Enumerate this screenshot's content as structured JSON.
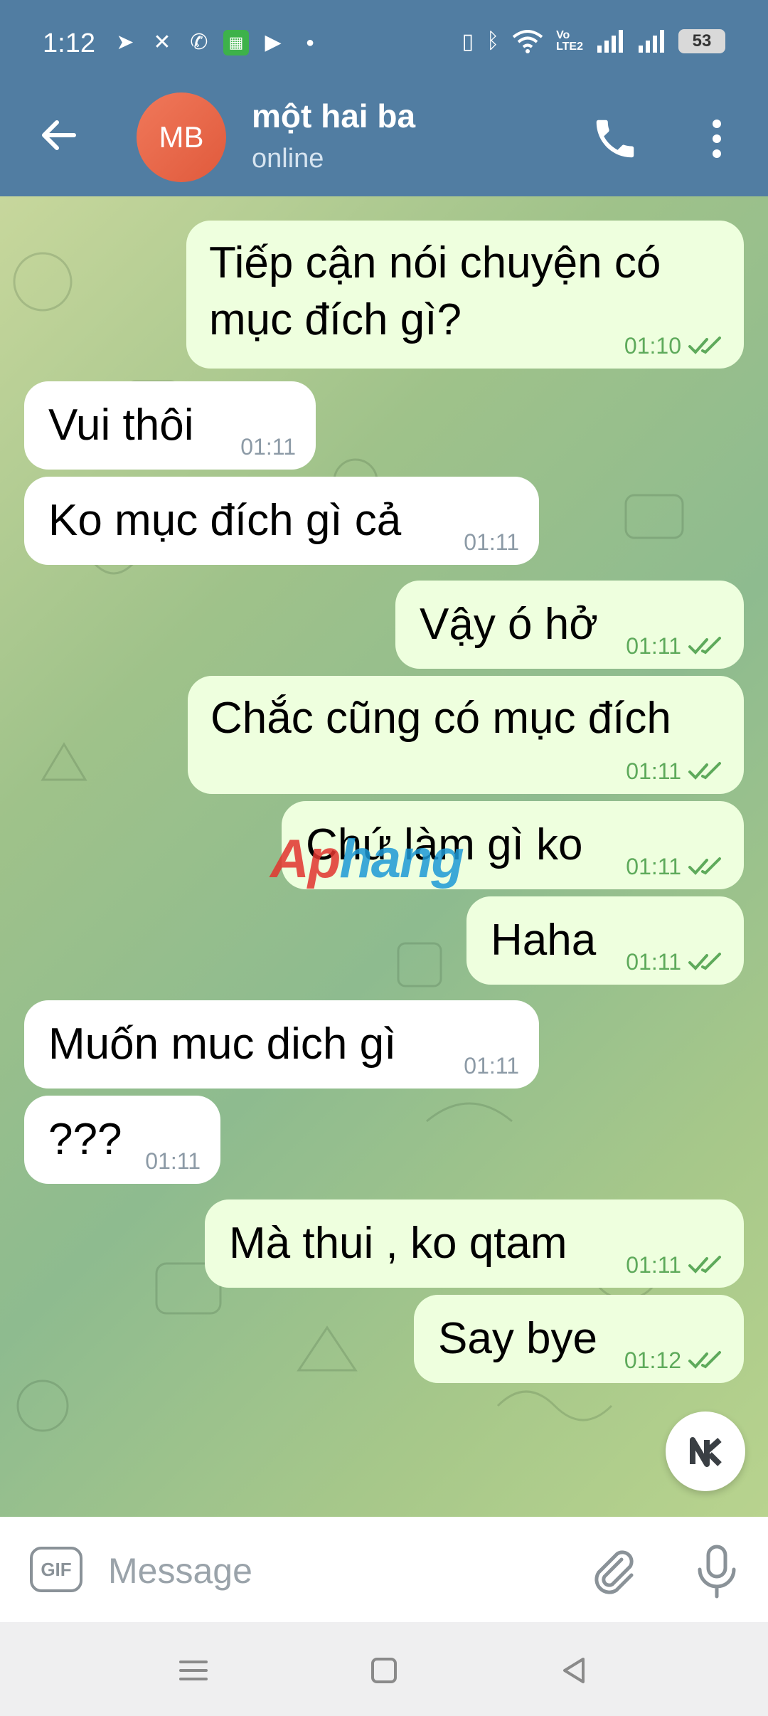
{
  "status_bar": {
    "time": "1:12",
    "icons_left": [
      "telegram-icon",
      "app-icon",
      "viber-icon",
      "calculator-icon",
      "youtube-icon",
      "dot-icon"
    ],
    "icons_right": [
      "vibrate-icon",
      "bluetooth-icon",
      "wifi-icon",
      "volte-icon",
      "signal-icon",
      "signal-icon",
      "battery-icon"
    ],
    "volte_line1": "Vo",
    "volte_line2": "LTE2",
    "battery": "53"
  },
  "header": {
    "avatar_initials": "MB",
    "avatar_color": "#E8664A",
    "contact_name": "một hai ba",
    "contact_status": "online",
    "bar_color": "#517DA2"
  },
  "messages": [
    {
      "direction": "out",
      "text": "Tiếp cận nói chuyện có mục đích gì?",
      "time": "01:10",
      "read": true
    },
    {
      "direction": "in",
      "text": "Vui thôi",
      "time": "01:11"
    },
    {
      "direction": "in",
      "text": "Ko mục đích gì cả",
      "time": "01:11"
    },
    {
      "direction": "out",
      "text": "Vậy ó hở",
      "time": "01:11",
      "read": true
    },
    {
      "direction": "out",
      "text": "Chắc cũng có mục đích",
      "time": "01:11",
      "read": true
    },
    {
      "direction": "out",
      "text": "Chứ làm gì ko",
      "time": "01:11",
      "read": true
    },
    {
      "direction": "out",
      "text": "Haha",
      "time": "01:11",
      "read": true
    },
    {
      "direction": "in",
      "text": "Muốn muc dich gì",
      "time": "01:11"
    },
    {
      "direction": "in",
      "text": "???",
      "time": "01:11"
    },
    {
      "direction": "out",
      "text": "Mà thui , ko qtam",
      "time": "01:11",
      "read": true
    },
    {
      "direction": "out",
      "text": "Say bye",
      "time": "01:12",
      "read": true
    }
  ],
  "watermark": {
    "part1": "Ap",
    "part2": "hang"
  },
  "composer": {
    "gif_label": "GIF",
    "placeholder": "Message"
  },
  "colors": {
    "incoming_bubble": "#FFFFFF",
    "outgoing_bubble": "#EEFFDE",
    "outgoing_meta": "#5EAA5B",
    "incoming_meta": "#8C9AA6"
  }
}
